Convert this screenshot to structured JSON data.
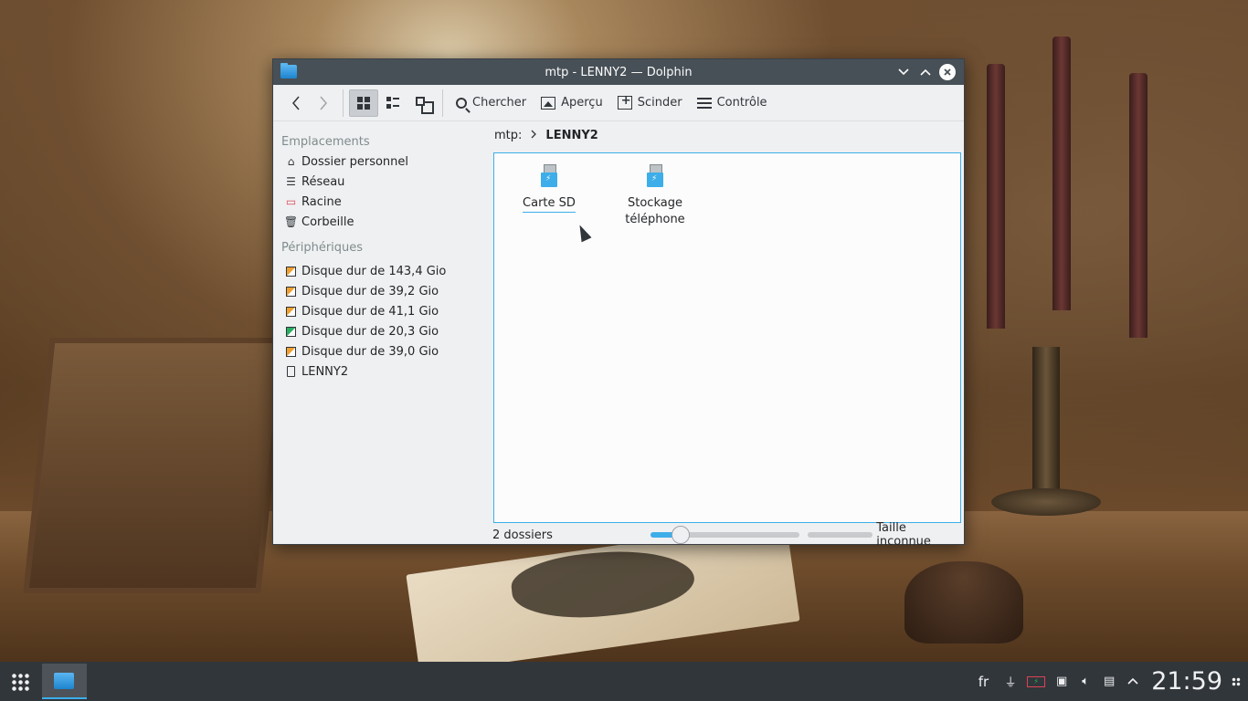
{
  "window": {
    "title": "mtp - LENNY2 — Dolphin"
  },
  "toolbar": {
    "back_icon": "arrow-left-icon",
    "forward_icon": "arrow-right-icon",
    "search_label": "Chercher",
    "preview_label": "Aperçu",
    "split_label": "Scinder",
    "control_label": "Contrôle"
  },
  "sidebar": {
    "places_title": "Emplacements",
    "places": [
      {
        "label": "Dossier personnel",
        "icon": "home-icon"
      },
      {
        "label": "Réseau",
        "icon": "network-icon"
      },
      {
        "label": "Racine",
        "icon": "root-folder-icon"
      },
      {
        "label": "Corbeille",
        "icon": "trash-icon"
      }
    ],
    "devices_title": "Périphériques",
    "devices": [
      {
        "label": "Disque dur de 143,4 Gio",
        "icon": "hard-disk-icon"
      },
      {
        "label": "Disque dur de 39,2 Gio",
        "icon": "hard-disk-icon"
      },
      {
        "label": "Disque dur de 41,1 Gio",
        "icon": "hard-disk-icon"
      },
      {
        "label": "Disque dur de 20,3 Gio",
        "icon": "hard-disk-icon"
      },
      {
        "label": "Disque dur de 39,0 Gio",
        "icon": "hard-disk-icon"
      },
      {
        "label": "LENNY2",
        "icon": "phone-icon"
      }
    ]
  },
  "breadcrumb": {
    "root": "mtp:",
    "current": "LENNY2"
  },
  "files": [
    {
      "label": "Carte SD",
      "icon": "usb-storage-icon"
    },
    {
      "label": "Stockage\ntéléphone",
      "icon": "usb-storage-icon"
    }
  ],
  "status": {
    "count_text": "2 dossiers",
    "zoom_fraction": 0.16,
    "space_text": "Taille inconnue"
  },
  "taskbar": {
    "language": "fr",
    "clock": "21:59"
  },
  "colors": {
    "accent": "#3daee9",
    "titlebar": "#475057",
    "taskbar": "#31363b"
  }
}
